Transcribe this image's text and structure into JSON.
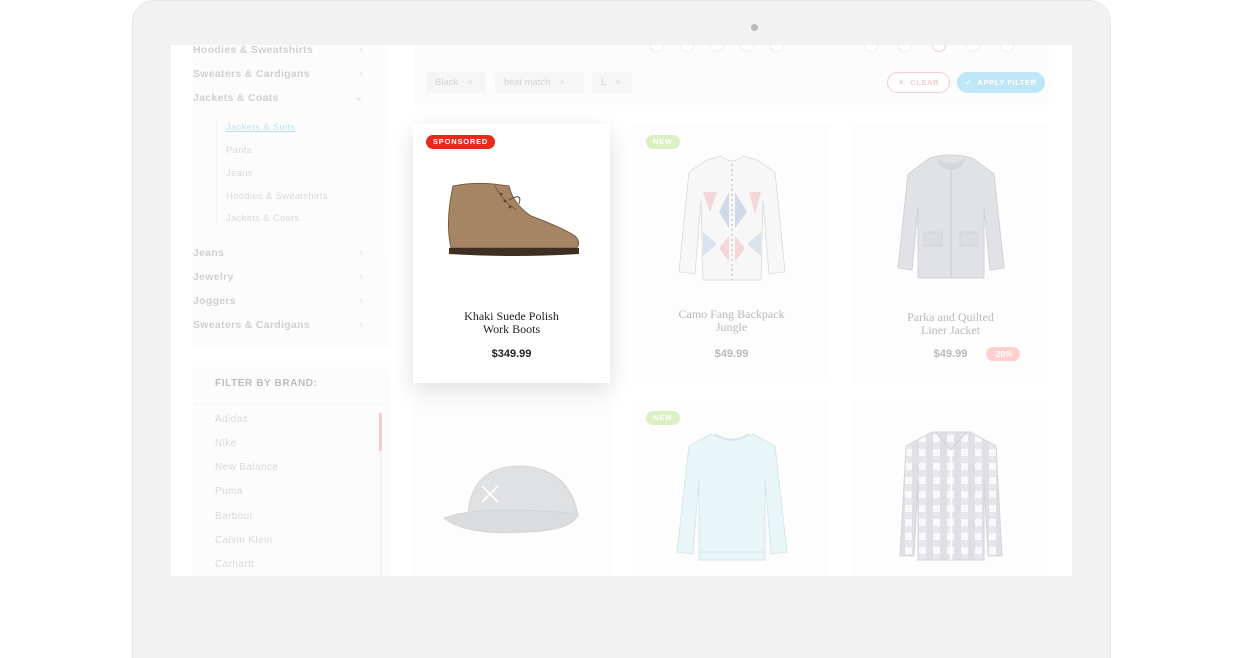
{
  "sidebar": {
    "categories_top": [
      {
        "label": "Hoodies & Sweatshirts"
      },
      {
        "label": "Sweaters & Cardigans"
      },
      {
        "label": "Jackets & Coats",
        "expanded": true
      }
    ],
    "subcategories": [
      {
        "label": "Jackets & Suits",
        "active": true
      },
      {
        "label": "Pants"
      },
      {
        "label": "Jeans"
      },
      {
        "label": "Hoodies & Sweatshirts"
      },
      {
        "label": "Jackets & Coats"
      }
    ],
    "categories_bottom": [
      {
        "label": "Jeans"
      },
      {
        "label": "Jewelry"
      },
      {
        "label": "Joggers"
      },
      {
        "label": "Sweaters & Cardigans"
      }
    ],
    "brand_filter": {
      "heading": "FILTER BY BRAND:",
      "brands": [
        "Adidas",
        "Nike",
        "New Balance",
        "Puma",
        "Barbour",
        "Calvin Klein",
        "Carhartt"
      ]
    }
  },
  "filters": {
    "active_chips": [
      "Black",
      "best match",
      "L"
    ],
    "clear_label": "CLEAR",
    "apply_label": "APPLY FILTER"
  },
  "products": [
    {
      "badge": "SPONSORED",
      "name_line1": "Khaki Suede Polish",
      "name_line2": "Work Boots",
      "price": "$349.99",
      "icon": "boot-image"
    },
    {
      "badge": "NEW",
      "name_line1": "Camo Fang Backpack",
      "name_line2": "Jungle",
      "price": "$49.99",
      "icon": "cardigan-image"
    },
    {
      "badge": "",
      "name_line1": "Parka and Quilted",
      "name_line2": "Liner Jacket",
      "price": "$49.99",
      "discount": "-20%",
      "icon": "parka-image"
    },
    {
      "badge": "",
      "icon": "cap-image"
    },
    {
      "badge": "NEW",
      "icon": "sweater-image"
    },
    {
      "badge": "",
      "icon": "shirt-image"
    }
  ],
  "colors": {
    "accent_blue": "#3cb4e8",
    "accent_red": "#e26060",
    "sponsored_red": "#e8291c",
    "new_green": "#8fcf3c"
  }
}
